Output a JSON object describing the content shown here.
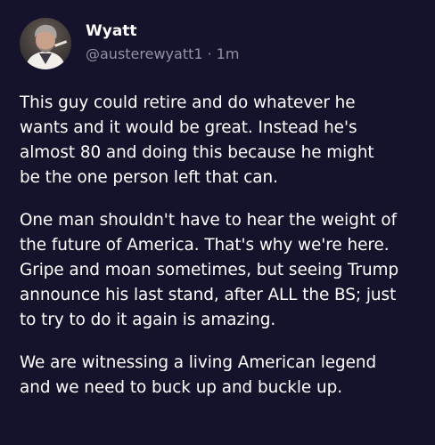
{
  "author": {
    "display_name": "Wyatt",
    "handle": "@austerewyatt1",
    "separator": "·",
    "timestamp": "1m",
    "avatar_icon": "user-avatar-photo"
  },
  "post": {
    "paragraphs": [
      "This guy could retire and do whatever he\nwants and it would be great. Instead he's\nalmost 80 and doing this because he might\nbe the one person left that can.",
      "One man shouldn't have to hear the weight of\nthe future of America. That's why we're here.\nGripe and moan sometimes, but seeing Trump\nannounce his last stand, after ALL the BS; just\nto try to do it again is amazing.",
      "We are witnessing a living American legend\nand we need to buck up and buckle up."
    ]
  },
  "colors": {
    "background": "#15122b",
    "text": "#ffffff",
    "muted_text": "#8f93a6"
  }
}
